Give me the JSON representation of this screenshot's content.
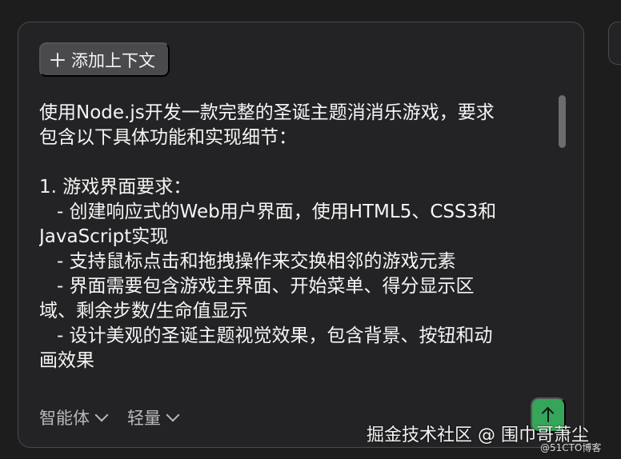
{
  "context_button": {
    "label": "添加上下文",
    "icon": "plus-icon"
  },
  "prompt": {
    "text": "使用Node.js开发一款完整的圣诞主题消消乐游戏，要求\n包含以下具体功能和实现细节：\n\n1. 游戏界面要求：\n   - 创建响应式的Web用户界面，使用HTML5、CSS3和\nJavaScript实现\n   - 支持鼠标点击和拖拽操作来交换相邻的游戏元素\n   - 界面需要包含游戏主界面、开始菜单、得分显示区\n域、剩余步数/生命值显示\n   - 设计美观的圣诞主题视觉效果，包含背景、按钮和动\n画效果"
  },
  "controls": {
    "agent_label": "智能体",
    "mode_label": "轻量",
    "dropdown_icon": "chevron-down-icon"
  },
  "send_button": {
    "icon": "arrow-up-icon",
    "color": "#35a55a"
  },
  "watermark": {
    "main": "掘金技术社区 @ 围巾哥萧尘",
    "sub": "@51CTO博客"
  },
  "colors": {
    "background": "#1d1d1e",
    "panel": "#232325",
    "button": "#4a4a4d",
    "accent": "#35a55a"
  }
}
